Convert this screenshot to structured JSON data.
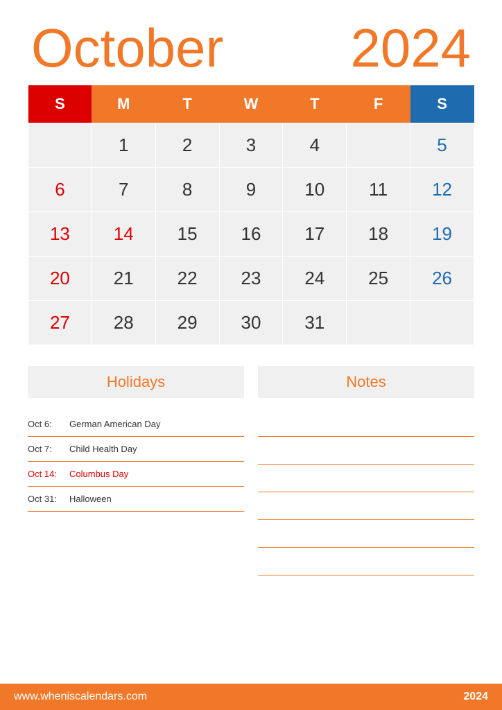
{
  "header": {
    "month": "October",
    "year": "2024"
  },
  "days_of_week": [
    "S",
    "M",
    "T",
    "W",
    "T",
    "F",
    "S"
  ],
  "calendar": {
    "rows": [
      [
        "",
        "1",
        "2",
        "3",
        "4",
        "5"
      ],
      [
        "6",
        "7",
        "8",
        "9",
        "10",
        "11",
        "12"
      ],
      [
        "13",
        "14",
        "15",
        "16",
        "17",
        "18",
        "19"
      ],
      [
        "20",
        "21",
        "22",
        "23",
        "24",
        "25",
        "26"
      ],
      [
        "27",
        "28",
        "29",
        "30",
        "31",
        "",
        ""
      ]
    ]
  },
  "holidays": {
    "title": "Holidays",
    "items": [
      {
        "date": "Oct 6:",
        "name": "German American Day",
        "highlight": false
      },
      {
        "date": "Oct 7:",
        "name": "Child Health Day",
        "highlight": false
      },
      {
        "date": "Oct 14:",
        "name": "Columbus Day",
        "highlight": true
      },
      {
        "date": "Oct 31:",
        "name": "Halloween",
        "highlight": false
      }
    ]
  },
  "notes": {
    "title": "Notes",
    "lines": 6
  },
  "footer": {
    "url": "www.wheniscalendars.com",
    "year": "2024"
  }
}
